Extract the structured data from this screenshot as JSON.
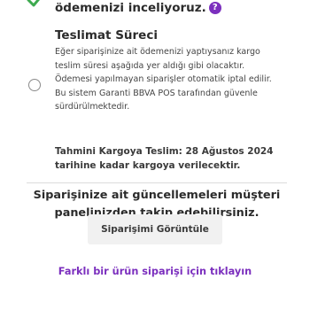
{
  "header": {
    "message": "ödemenizi inceliyoruz.",
    "help_icon_glyph": "?"
  },
  "shipping": {
    "title": "Teslimat Süreci",
    "description": "Eğer siparişinize ait ödemenizi yaptıysanız kargo teslim süresi aşağıda yer aldığı gibi olacaktır. Ödemesi yapılmayan siparişler otomatik iptal edilir. Bu sistem Garanti BBVA POS tarafından güvenle sürdürülmektedir.",
    "delivery_info": "Tahmini Kargoya Teslim: 28 Ağustos 2024 tarihine kadar kargoya verilecektir."
  },
  "notice": "Siparişinize ait güncellemeleri müşteri panelinizden takip edebilirsiniz.",
  "buttons": {
    "view_order": "Siparişimi Görüntüle"
  },
  "links": {
    "other_order": "Farklı bir ürün siparişi için tıklayın"
  },
  "colors": {
    "accent": "#7b2fbe",
    "check": "#3daa4f"
  },
  "icons": {
    "check": "check-icon",
    "help": "help-icon"
  }
}
